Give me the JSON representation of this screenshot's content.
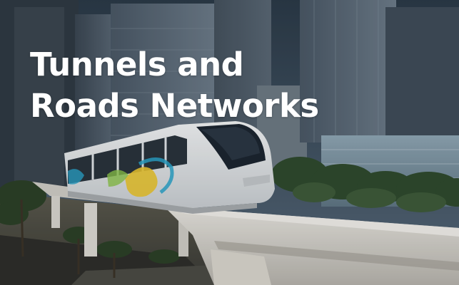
{
  "card": {
    "title_line_1": "Tunnels and",
    "title_line_2": "Roads Networks",
    "image_icon": "monorail-city-scene",
    "colors": {
      "title_text": "#ffffff",
      "sky": "#3e5060",
      "train_body": "#dfe3e6"
    }
  }
}
